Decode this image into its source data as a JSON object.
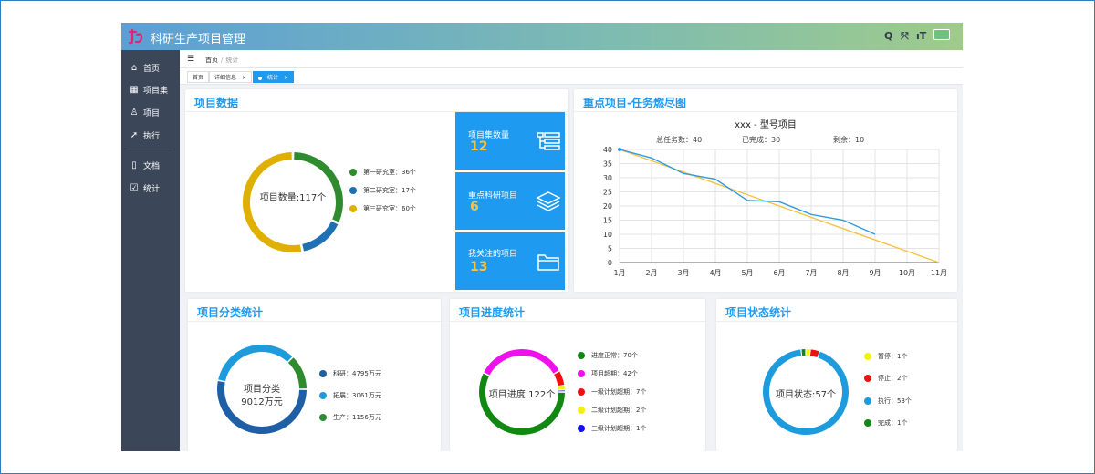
{
  "app": {
    "title": "科研生产项目管理"
  },
  "topbar": {
    "icons": [
      "search-icon",
      "fullscreen-icon",
      "font-size-icon",
      "theme-badge-icon"
    ],
    "search_glyph": "Q",
    "fullscreen_glyph": "⤧",
    "font_glyph": "ıT"
  },
  "sidebar": {
    "items": [
      {
        "label": "首页",
        "icon": "home-icon",
        "glyph": "⌂"
      },
      {
        "label": "项目集",
        "icon": "grid-icon",
        "glyph": "▦"
      },
      {
        "label": "项目",
        "icon": "bell-icon",
        "glyph": "♙"
      },
      {
        "label": "执行",
        "icon": "run-icon",
        "glyph": "➚"
      },
      {
        "label": "文档",
        "icon": "document-icon",
        "glyph": "▯"
      },
      {
        "label": "统计",
        "icon": "stats-icon",
        "glyph": "☑"
      }
    ]
  },
  "breadcrumb": {
    "toggle_glyph": "☰",
    "home": "首页",
    "separator": "/",
    "current": "统计"
  },
  "tabs": [
    {
      "label": "首页",
      "close": ""
    },
    {
      "label": "详细信息",
      "close": "×"
    },
    {
      "label": "统计",
      "close": "×",
      "active": true
    }
  ],
  "project_data": {
    "title": "项目数据",
    "donut": {
      "center_label": "项目数量:117个",
      "segments": [
        {
          "label": "第一研究室：36个",
          "value": 36,
          "color": "#2e8b2e"
        },
        {
          "label": "第二研究室：17个",
          "value": 17,
          "color": "#1f6fb5"
        },
        {
          "label": "第三研究室：60个",
          "value": 60,
          "color": "#e0b000"
        }
      ]
    },
    "tiles": [
      {
        "label": "项目集数量",
        "value": "12",
        "icon": "list-icon"
      },
      {
        "label": "重点科研项目",
        "value": "6",
        "icon": "layers-icon"
      },
      {
        "label": "我关注的项目",
        "value": "13",
        "icon": "folder-icon"
      }
    ]
  },
  "burndown": {
    "title": "重点项目-任务燃尽图",
    "chart_title": "xxx - 型号项目",
    "stats": {
      "total": "总任务数：40",
      "done": "已完成：30",
      "remaining": "剩余：10"
    }
  },
  "chart_data": {
    "type": "line",
    "title": "xxx - 型号项目",
    "categories": [
      "1月",
      "2月",
      "3月",
      "4月",
      "5月",
      "6月",
      "7月",
      "8月",
      "9月",
      "10月",
      "11月"
    ],
    "ylim": [
      0,
      40
    ],
    "yticks": [
      0,
      5,
      10,
      15,
      20,
      25,
      30,
      35,
      40
    ],
    "grid": true,
    "series": [
      {
        "values": [
          40,
          37,
          31.5,
          29.5,
          22,
          21.5,
          17,
          15,
          10,
          null,
          null
        ],
        "color": "#2f9be0"
      },
      {
        "values": [
          40,
          36,
          32,
          28,
          24,
          20,
          16,
          12,
          8,
          4,
          0
        ],
        "color": "#f5c242"
      }
    ]
  },
  "category_stats": {
    "title": "项目分类统计",
    "donut": {
      "center_line1": "项目分类",
      "center_line2": "9012万元",
      "segments": [
        {
          "label": "科研：4795万元",
          "value": 4795,
          "color": "#1f5fa5"
        },
        {
          "label": "拓展：3061万元",
          "value": 3061,
          "color": "#1e9bdc"
        },
        {
          "label": "生产：1156万元",
          "value": 1156,
          "color": "#2e8b2e"
        }
      ]
    }
  },
  "progress_stats": {
    "title": "项目进度统计",
    "donut": {
      "center_label": "项目进度:122个",
      "segments": [
        {
          "label": "进度正常：70个",
          "value": 70,
          "color": "#118811"
        },
        {
          "label": "项目超期：42个",
          "value": 42,
          "color": "#ee11ee"
        },
        {
          "label": "一级计划超期：7个",
          "value": 7,
          "color": "#ee1111"
        },
        {
          "label": "二级计划超期：2个",
          "value": 2,
          "color": "#f2f20a"
        },
        {
          "label": "三级计划超期：1个",
          "value": 1,
          "color": "#1111ee"
        }
      ]
    }
  },
  "status_stats": {
    "title": "项目状态统计",
    "donut": {
      "center_label": "项目状态:57个",
      "segments": [
        {
          "label": "暂停：1个",
          "value": 1,
          "color": "#f2f20a"
        },
        {
          "label": "停止：2个",
          "value": 2,
          "color": "#ee1111"
        },
        {
          "label": "执行：53个",
          "value": 53,
          "color": "#1e9bdc"
        },
        {
          "label": "完成：1个",
          "value": 1,
          "color": "#118811"
        }
      ]
    }
  }
}
